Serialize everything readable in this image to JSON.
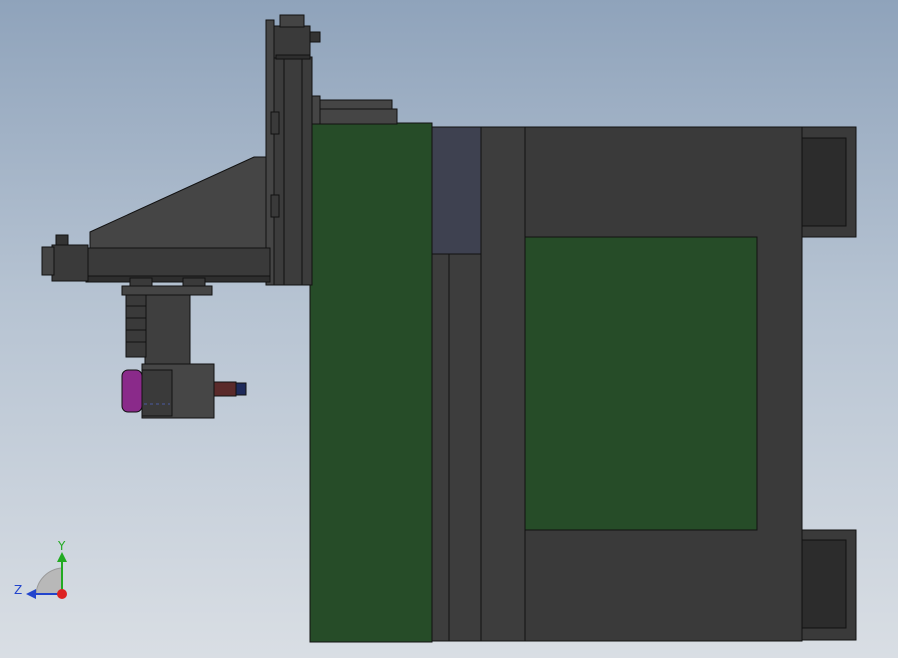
{
  "viewport": {
    "background_top": "#8fa3bb",
    "background_bottom": "#d9dee4"
  },
  "colors": {
    "body_dark": "#3a3a3a",
    "body_mid": "#454545",
    "green_panel": "#264c28",
    "slate_panel": "#3e4150",
    "spindle_purple": "#8a2a8a",
    "edge": "#111111"
  },
  "triad": {
    "x_axis_label": "",
    "y_axis_label": "Y",
    "z_axis_label": "Z",
    "y_color": "#22aa22",
    "z_color": "#2244cc",
    "x_color": "#dd2222"
  }
}
